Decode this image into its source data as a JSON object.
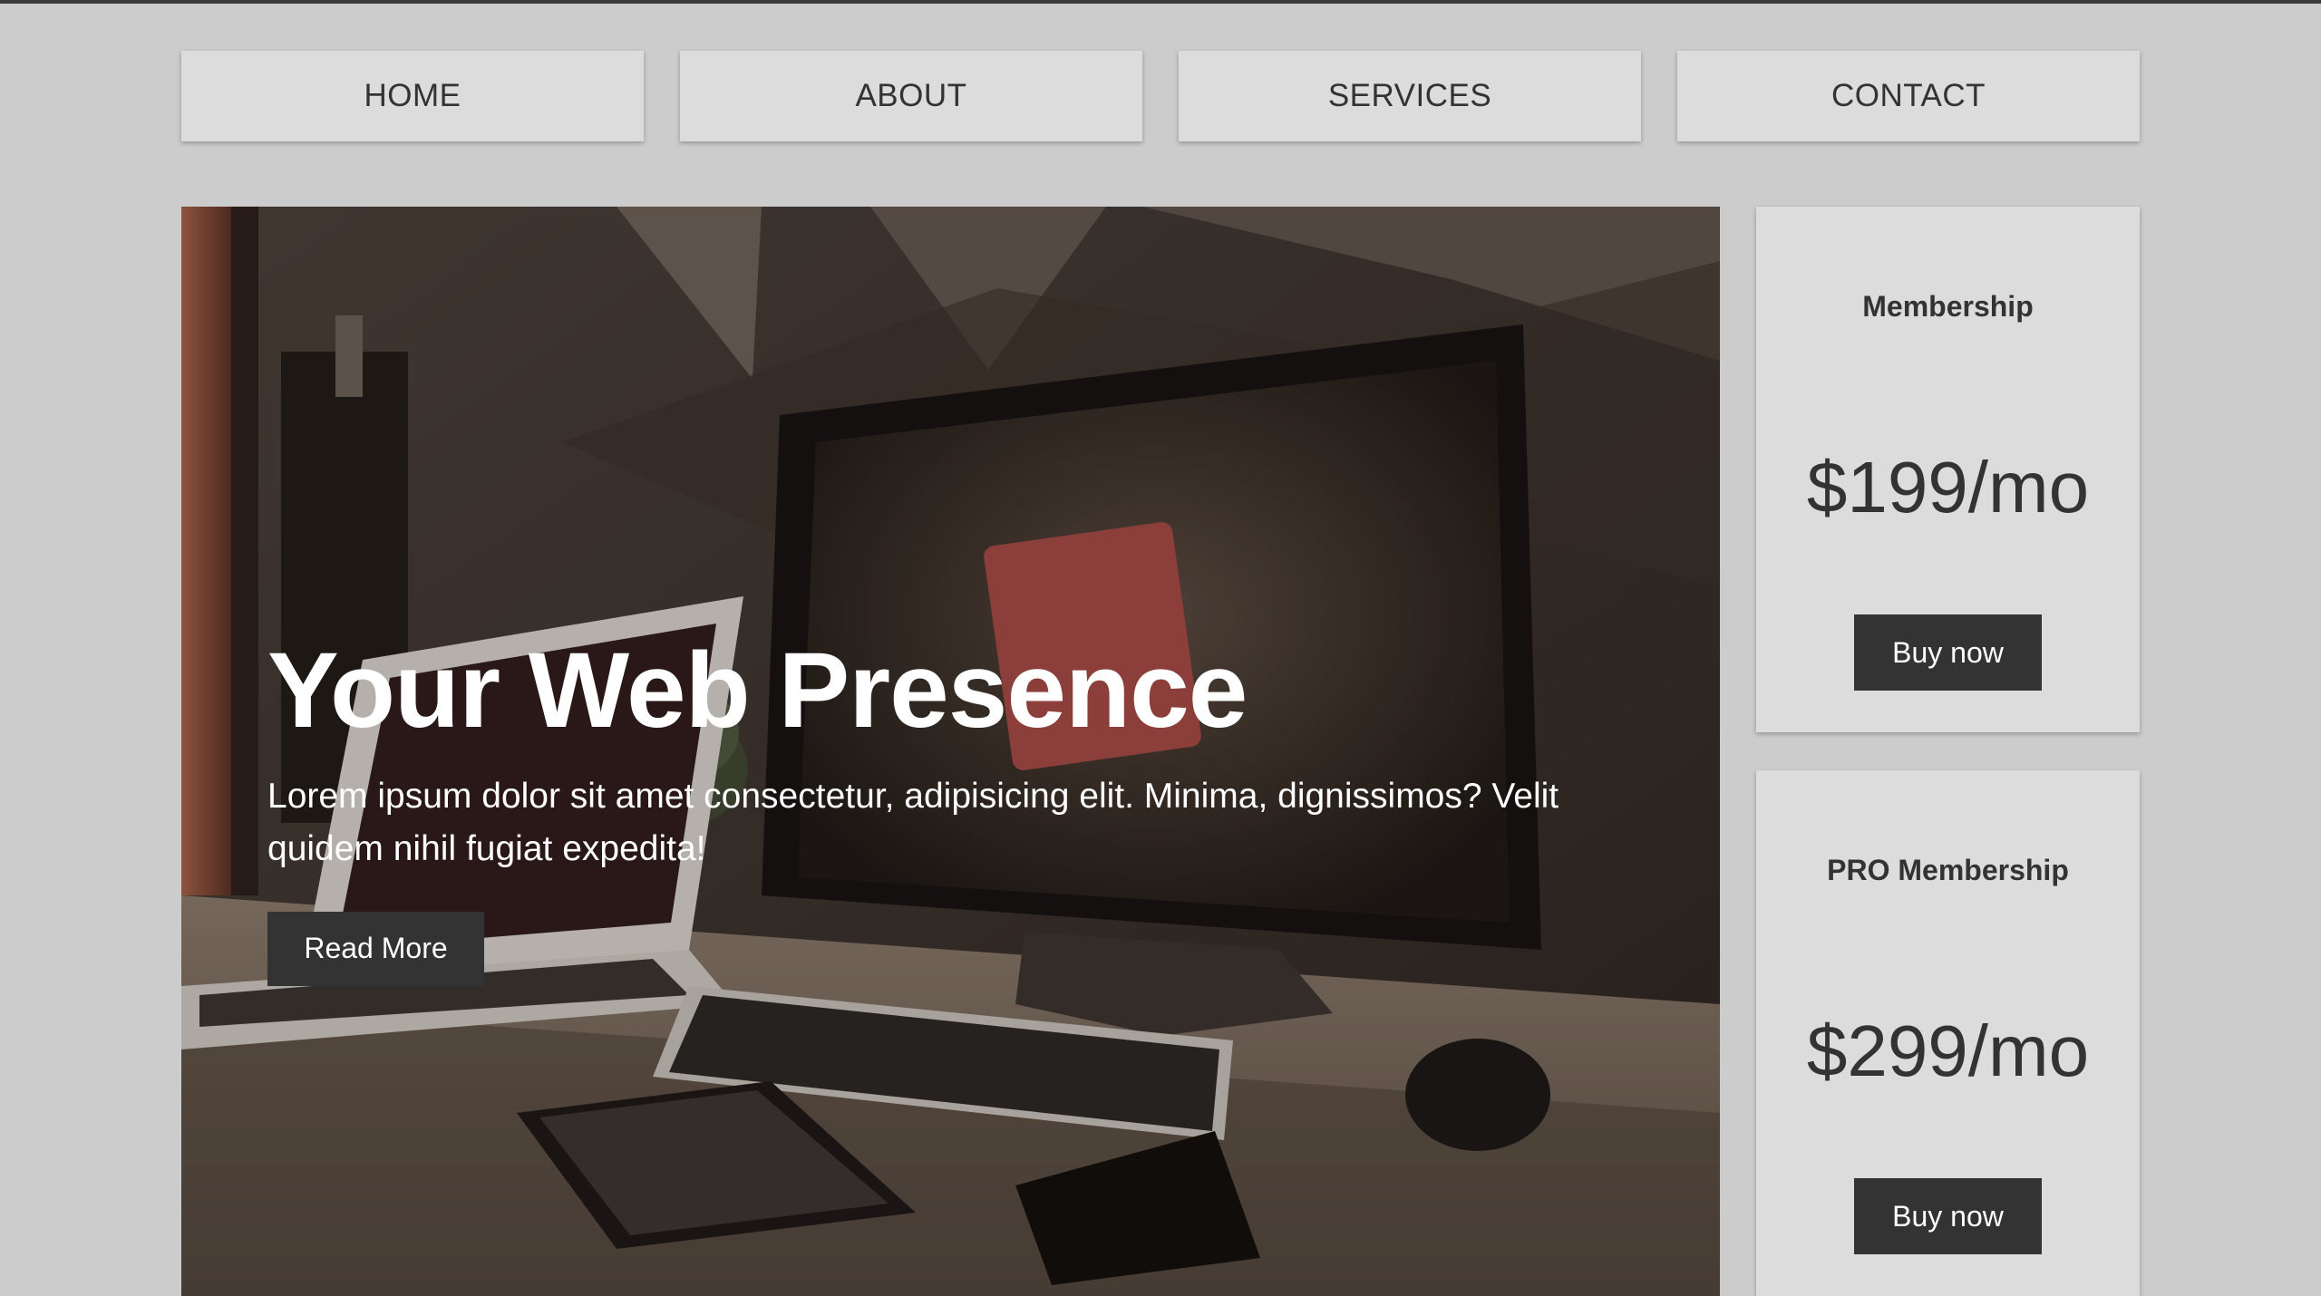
{
  "nav": {
    "items": [
      {
        "label": "HOME"
      },
      {
        "label": "ABOUT"
      },
      {
        "label": "SERVICES"
      },
      {
        "label": "CONTACT"
      }
    ]
  },
  "hero": {
    "title": "Your Web Presence",
    "text": "Lorem ipsum dolor sit amet consectetur, adipisicing elit. Minima, dignissimos? Velit quidem nihil fugiat expedita!",
    "button_label": "Read More",
    "image_description_icon": "desk-computer-photo"
  },
  "pricing": [
    {
      "title": "Membership",
      "price": "$199/mo",
      "button_label": "Buy now"
    },
    {
      "title": "PRO Membership",
      "price": "$299/mo",
      "button_label": "Buy now"
    }
  ],
  "colors": {
    "page_background": "#cccccc",
    "card_background": "#dcdcdc",
    "button_background": "#333333",
    "text": "#333333"
  }
}
